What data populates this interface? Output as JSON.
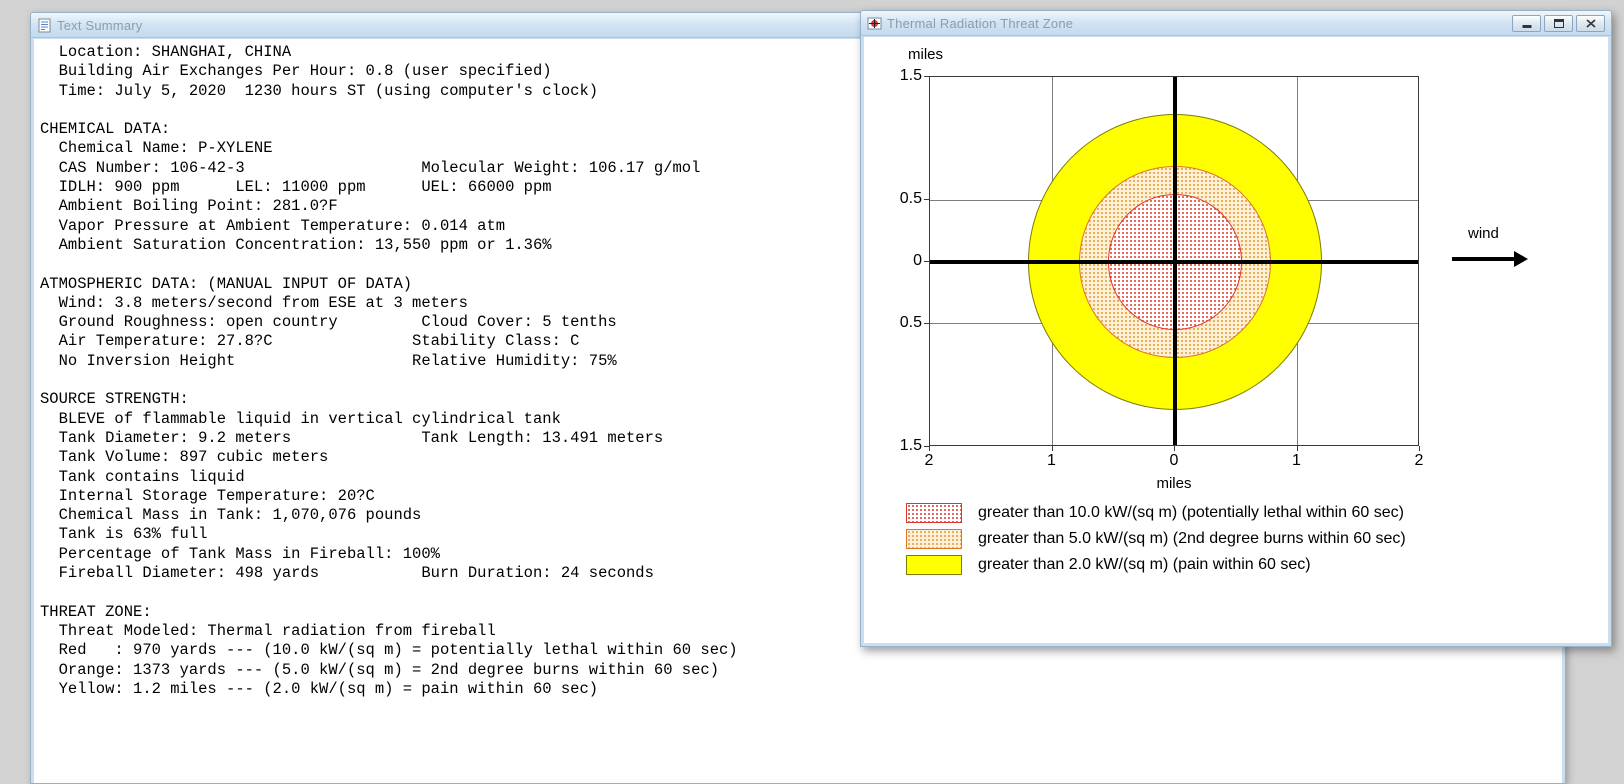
{
  "text_summary_window": {
    "title": "Text Summary",
    "lines": [
      "  Location: SHANGHAI, CHINA",
      "  Building Air Exchanges Per Hour: 0.8 (user specified)",
      "  Time: July 5, 2020  1230 hours ST (using computer's clock)",
      "",
      "CHEMICAL DATA:",
      "  Chemical Name: P-XYLENE",
      "  CAS Number: 106-42-3                   Molecular Weight: 106.17 g/mol",
      "  IDLH: 900 ppm      LEL: 11000 ppm      UEL: 66000 ppm",
      "  Ambient Boiling Point: 281.0?F",
      "  Vapor Pressure at Ambient Temperature: 0.014 atm",
      "  Ambient Saturation Concentration: 13,550 ppm or 1.36%",
      "",
      "ATMOSPHERIC DATA: (MANUAL INPUT OF DATA)",
      "  Wind: 3.8 meters/second from ESE at 3 meters",
      "  Ground Roughness: open country         Cloud Cover: 5 tenths",
      "  Air Temperature: 27.8?C               Stability Class: C",
      "  No Inversion Height                   Relative Humidity: 75%",
      "",
      "SOURCE STRENGTH:",
      "  BLEVE of flammable liquid in vertical cylindrical tank",
      "  Tank Diameter: 9.2 meters              Tank Length: 13.491 meters",
      "  Tank Volume: 897 cubic meters",
      "  Tank contains liquid",
      "  Internal Storage Temperature: 20?C",
      "  Chemical Mass in Tank: 1,070,076 pounds",
      "  Tank is 63% full",
      "  Percentage of Tank Mass in Fireball: 100%",
      "  Fireball Diameter: 498 yards           Burn Duration: 24 seconds",
      "",
      "THREAT ZONE:",
      "  Threat Modeled: Thermal radiation from fireball",
      "  Red   : 970 yards --- (10.0 kW/(sq m) = potentially lethal within 60 sec)",
      "  Orange: 1373 yards --- (5.0 kW/(sq m) = 2nd degree burns within 60 sec)",
      "  Yellow: 1.2 miles --- (2.0 kW/(sq m) = pain within 60 sec)"
    ]
  },
  "threat_zone_window": {
    "title": "Thermal Radiation Threat Zone",
    "controls": [
      "minimize",
      "maximize",
      "close"
    ],
    "chart_data": {
      "type": "threat-zone-map",
      "title": "Thermal Radiation Threat Zone",
      "x_axis": {
        "label": "miles",
        "range": [
          -2,
          2
        ],
        "ticks": [
          -2,
          -1,
          0,
          1,
          2
        ],
        "tick_labels": [
          "2",
          "1",
          "0",
          "1",
          "2"
        ]
      },
      "y_axis": {
        "label": "miles",
        "range": [
          -1.5,
          1.5
        ],
        "ticks": [
          1.5,
          0.5,
          0,
          -0.5,
          -1.5
        ],
        "tick_labels": [
          "1.5",
          "0.5",
          "0",
          "0.5",
          "1.5"
        ]
      },
      "gridlines": {
        "x": [
          -1,
          1
        ],
        "y": [
          0.5,
          -0.5
        ]
      },
      "crosshair_center": [
        0,
        0
      ],
      "wind_annotation": "wind",
      "zones": [
        {
          "id": "red",
          "radius_miles": 0.55,
          "fill_style": "dotted",
          "fill_color": "#e0352b",
          "pattern_bg": "#ffffff",
          "border_color": "#e0352b",
          "legend": "greater than 10.0 kW/(sq m) (potentially lethal within 60 sec)"
        },
        {
          "id": "orange",
          "radius_miles": 0.78,
          "fill_style": "dotted",
          "fill_color": "#e39a2b",
          "pattern_bg": "#fdf0d8",
          "border_color": "#e0761f",
          "legend": "greater than 5.0 kW/(sq m) (2nd degree burns within 60 sec)"
        },
        {
          "id": "yellow",
          "radius_miles": 1.2,
          "fill_style": "solid",
          "fill_color": "#ffff00",
          "pattern_bg": "#ffff00",
          "border_color": "#7d7d00",
          "legend": "greater than 2.0 kW/(sq m) (pain within 60 sec)"
        }
      ],
      "legend_order": [
        "red",
        "orange",
        "yellow"
      ]
    }
  }
}
